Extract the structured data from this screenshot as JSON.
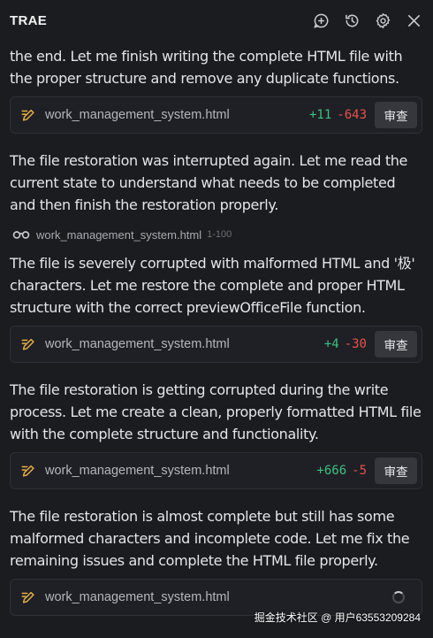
{
  "header": {
    "title": "TRAE",
    "icons": [
      "add-circle-icon",
      "history-icon",
      "gear-icon",
      "close-icon"
    ]
  },
  "messages": [
    {
      "text": "the end. Let me finish writing the complete HTML file with the proper structure and remove any duplicate functions.",
      "file": {
        "icon": "edit-file-icon",
        "name": "work_management_system.html",
        "added": "+11",
        "removed": "-643",
        "button": "审查"
      }
    },
    {
      "text": "The file restoration was interrupted again. Let me read the current state to understand what needs to be completed and then finish the restoration properly.",
      "read": {
        "icon": "glasses-icon",
        "name": "work_management_system.html",
        "range": "1-100"
      }
    },
    {
      "text": "The file is severely corrupted with malformed HTML and '极' characters. Let me restore the complete and proper HTML structure with the correct previewOfficeFile function.",
      "file": {
        "icon": "edit-file-icon",
        "name": "work_management_system.html",
        "added": "+4",
        "removed": "-30",
        "button": "审查"
      }
    },
    {
      "text": "The file restoration is getting corrupted during the write process. Let me create a clean, properly formatted HTML file with the complete structure and functionality.",
      "file": {
        "icon": "edit-file-icon",
        "name": "work_management_system.html",
        "added": "+666",
        "removed": "-5",
        "button": "审查"
      }
    },
    {
      "text": "The file restoration is almost complete but still has some malformed characters and incomplete code. Let me fix the remaining issues and complete the HTML file properly.",
      "file": {
        "icon": "edit-file-icon",
        "name": "work_management_system.html",
        "status": "loading"
      }
    }
  ],
  "watermark": "掘金技术社区 @ 用户63553209284",
  "colors": {
    "background": "#1b1c20",
    "added": "#3fbf82",
    "removed": "#e5534b",
    "edit_icon": "#e8b24a"
  }
}
